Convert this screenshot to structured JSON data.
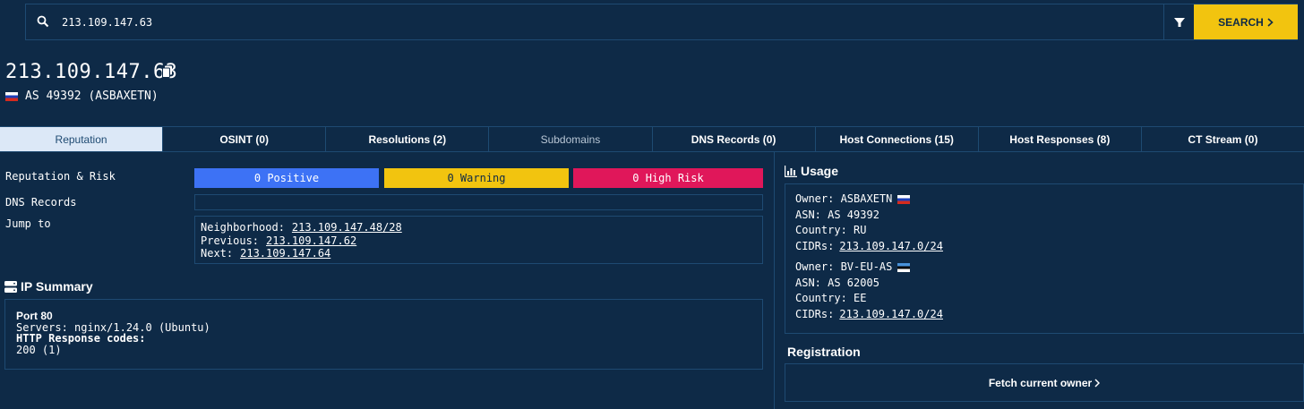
{
  "search": {
    "value": "213.109.147.63",
    "button_label": "SEARCH"
  },
  "header": {
    "ip": "213.109.147.63",
    "asn": "AS 49392 (ASBAXETN)"
  },
  "tabs": [
    {
      "label": "Reputation"
    },
    {
      "label": "OSINT (0)"
    },
    {
      "label": "Resolutions (2)"
    },
    {
      "label": "Subdomains"
    },
    {
      "label": "DNS Records (0)"
    },
    {
      "label": "Host Connections (15)"
    },
    {
      "label": "Host Responses (8)"
    },
    {
      "label": "CT Stream (0)"
    }
  ],
  "reputation": {
    "label": "Reputation & Risk",
    "positive": "0 Positive",
    "warning": "0 Warning",
    "high_risk": "0 High Risk",
    "colors": {
      "positive": "#3d72f5",
      "warning": "#f2c40f",
      "high_risk": "#e0175a"
    }
  },
  "dns_records": {
    "label": "DNS Records"
  },
  "jump": {
    "label": "Jump to",
    "neighborhood_label": "Neighborhood:",
    "neighborhood_value": "213.109.147.48/28",
    "previous_label": "Previous:",
    "previous_value": "213.109.147.62",
    "next_label": "Next:",
    "next_value": "213.109.147.64"
  },
  "ip_summary": {
    "title": "IP Summary",
    "port": "Port 80",
    "servers": "Servers: nginx/1.24.0 (Ubuntu)",
    "http_label": "HTTP Response codes:",
    "http_value": "200 (1)"
  },
  "usage": {
    "title": "Usage",
    "owners": [
      {
        "owner": "Owner: ASBAXETN",
        "asn": "ASN: AS 49392",
        "country": "Country: RU",
        "cidrs_label": "CIDRs:",
        "cidrs_value": "213.109.147.0/24",
        "flag": "ru-flag"
      },
      {
        "owner": "Owner: BV-EU-AS",
        "asn": "ASN: AS 62005",
        "country": "Country: EE",
        "cidrs_label": "CIDRs:",
        "cidrs_value": "213.109.147.0/24",
        "flag": "ee-flag"
      }
    ]
  },
  "registration": {
    "title": "Registration",
    "fetch_label": "Fetch current owner"
  },
  "colors": {
    "background": "#0e2a47",
    "border": "#1e4a72",
    "accent": "#f2c40f",
    "active_tab": "#dce8f7"
  }
}
